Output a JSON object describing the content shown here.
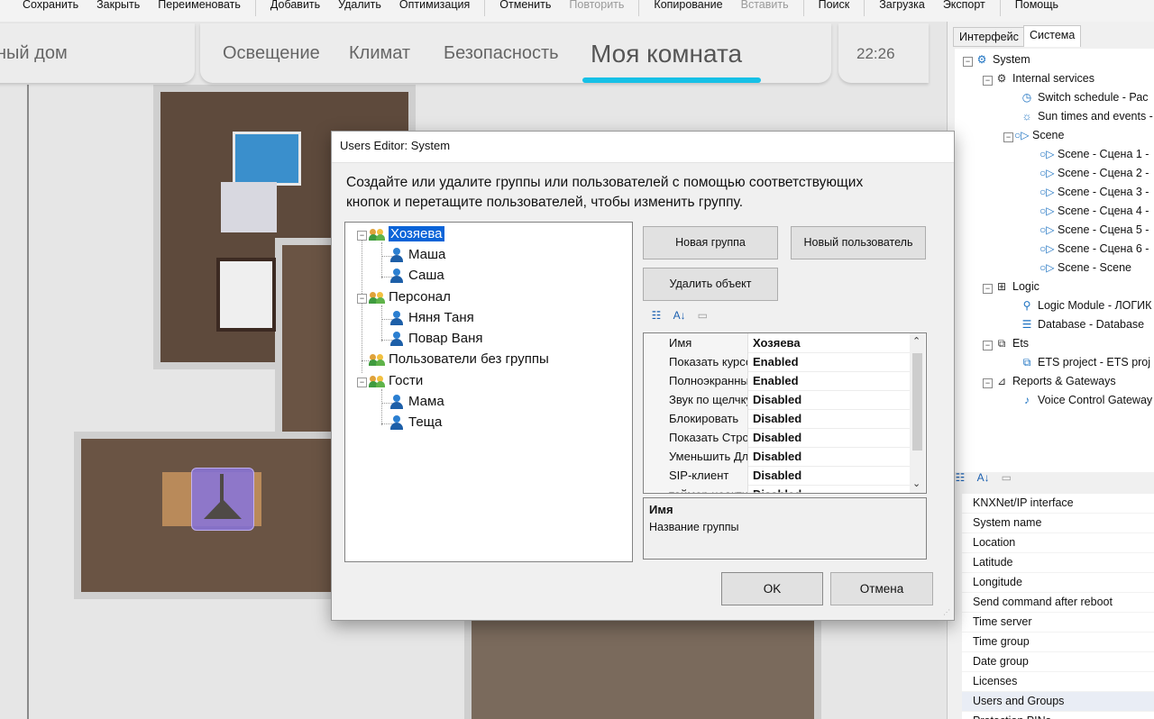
{
  "menu": {
    "items": [
      {
        "label": "Сохранить",
        "disabled": false
      },
      {
        "label": "Закрыть",
        "disabled": false
      },
      {
        "label": "Переименовать",
        "disabled": false
      },
      {
        "label": "Добавить",
        "disabled": false
      },
      {
        "label": "Удалить",
        "disabled": false
      },
      {
        "label": "Оптимизация",
        "disabled": false
      },
      {
        "label": "Отменить",
        "disabled": false
      },
      {
        "label": "Повторить",
        "disabled": true
      },
      {
        "label": "Копирование",
        "disabled": false
      },
      {
        "label": "Вставить",
        "disabled": true
      },
      {
        "label": "Поиск",
        "disabled": false
      },
      {
        "label": "Загрузка",
        "disabled": false
      },
      {
        "label": "Экспорт",
        "disabled": false
      },
      {
        "label": "Помощь",
        "disabled": false
      }
    ]
  },
  "viz": {
    "home_tab": "ный дом",
    "tabs": [
      "Освещение",
      "Климат",
      "Безопасность",
      "Моя комната"
    ],
    "active_tab": "Моя комната",
    "clock": "22:26",
    "accent_color": "#16c0e6"
  },
  "right_panel": {
    "tabs": [
      "Интерфейс",
      "Система"
    ],
    "active_tab": "Система",
    "tree": {
      "system": "System",
      "internal_services": "Internal services",
      "switch_schedule": "Switch schedule - Рас",
      "sun_times": "Sun times and events -",
      "scene": "Scene",
      "scenes": [
        "Scene - Сцена 1 -",
        "Scene - Сцена 2 -",
        "Scene - Сцена 3 -",
        "Scene - Сцена 4 -",
        "Scene - Сцена 5 -",
        "Scene - Сцена 6 -",
        "Scene - Scene"
      ],
      "logic": "Logic",
      "logic_module": "Logic Module - ЛОГИК",
      "database": "Database - Database",
      "ets": "Ets",
      "ets_project": "ETS project - ETS proj",
      "reports": "Reports & Gateways",
      "voice": "Voice Control Gateway"
    },
    "properties": [
      "KNXNet/IP interface",
      "System name",
      "Location",
      "Latitude",
      "Longitude",
      "Send command after reboot",
      "Time server",
      "Time group",
      "Date group",
      "Licenses",
      "Users and Groups",
      "Protection PINs"
    ],
    "selected_property": "Users and Groups"
  },
  "dialog": {
    "title": "Users Editor: System",
    "instruction_line1": "Создайте или удалите группы или пользователей с помощью соответствующих",
    "instruction_line2": "кнопок и перетащите пользователей, чтобы изменить группу.",
    "tree": {
      "group1": "Хозяева",
      "g1_users": [
        "Маша",
        "Саша"
      ],
      "group2": "Персонал",
      "g2_users": [
        "Няня Таня",
        "Повар Ваня"
      ],
      "ungrouped": "Пользователи без группы",
      "group3": "Гости",
      "g3_users": [
        "Мама",
        "Теща"
      ]
    },
    "buttons": {
      "new_group": "Новая группа",
      "new_user": "Новый пользователь",
      "delete": "Удалить объект",
      "ok": "OK",
      "cancel": "Отмена"
    },
    "grid": [
      {
        "key": "Имя",
        "value": "Хозяева"
      },
      {
        "key": "Показать курсор",
        "value": "Enabled"
      },
      {
        "key": "Полноэкранный",
        "value": "Enabled"
      },
      {
        "key": "Звук по щелчку",
        "value": "Disabled"
      },
      {
        "key": "Блокировать",
        "value": "Disabled"
      },
      {
        "key": "Показать Строку С",
        "value": "Disabled"
      },
      {
        "key": "Уменьшить Длител",
        "value": "Disabled"
      },
      {
        "key": "SIP-клиент",
        "value": "Disabled"
      },
      {
        "key": "таймер неактивнос",
        "value": "Disabled"
      }
    ],
    "description": {
      "title": "Имя",
      "text": "Название группы"
    }
  }
}
